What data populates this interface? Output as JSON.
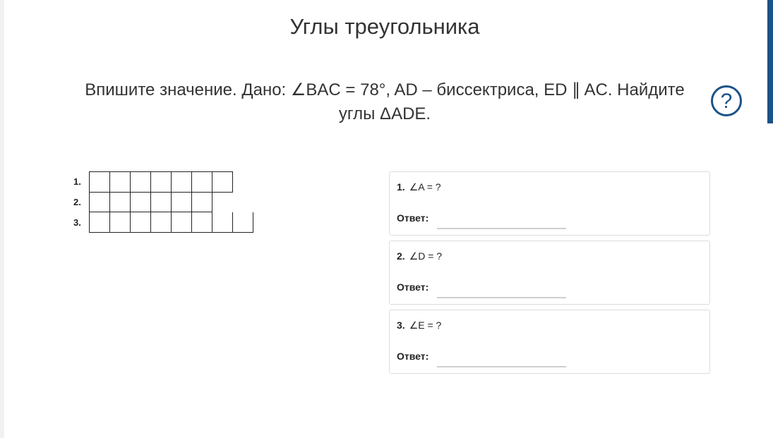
{
  "page": {
    "title": "Углы треугольника",
    "task": "Впишите значение. Дано: ∠BAC = 78°, AD – биссектриса, ED ∥ AC. Найдите углы ΔADE."
  },
  "help": {
    "icon": "help-icon",
    "symbol": "?"
  },
  "grid": {
    "rows": [
      {
        "label": "1.",
        "cells": 7
      },
      {
        "label": "2.",
        "cells": 6
      },
      {
        "label": "3.",
        "cells": 8
      }
    ]
  },
  "questions": [
    {
      "number": "1.",
      "text": "∠A = ?",
      "answer_label": "Ответ:",
      "value": ""
    },
    {
      "number": "2.",
      "text": "∠D = ?",
      "answer_label": "Ответ:",
      "value": ""
    },
    {
      "number": "3.",
      "text": "∠E = ?",
      "answer_label": "Ответ:",
      "value": ""
    }
  ],
  "colors": {
    "accent": "#1b5387"
  }
}
